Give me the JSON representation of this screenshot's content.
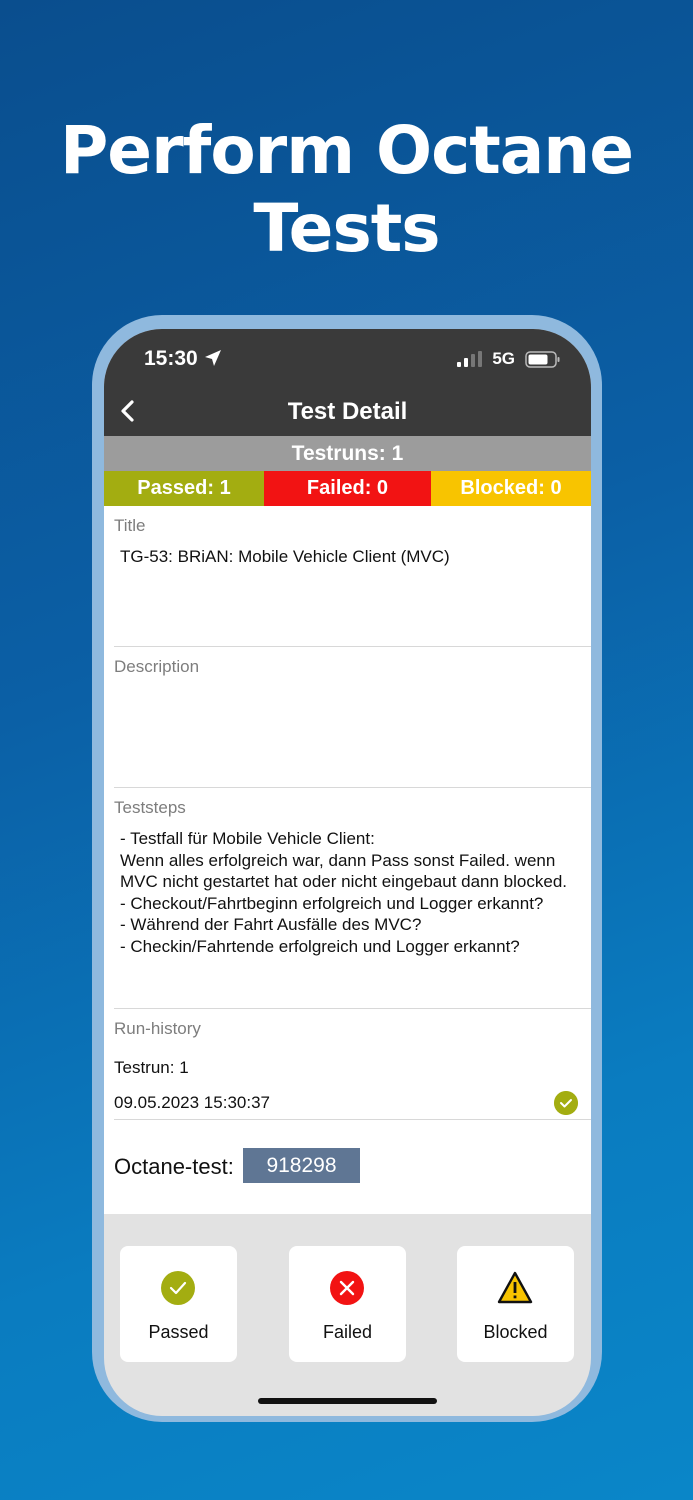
{
  "headline": {
    "line1": "Perform Octane",
    "line2": "Tests"
  },
  "status_bar": {
    "time": "15:30",
    "network": "5G"
  },
  "nav": {
    "title": "Test Detail"
  },
  "summary": {
    "testruns": "Testruns: 1",
    "passed": "Passed: 1",
    "failed": "Failed: 0",
    "blocked": "Blocked: 0"
  },
  "fields": {
    "title_label": "Title",
    "title_value": "TG-53: BRiAN: Mobile Vehicle Client (MVC)",
    "description_label": "Description",
    "description_value": "",
    "teststeps_label": "Teststeps",
    "teststeps_value": "- Testfall für Mobile Vehicle Client:\nWenn alles erfolgreich war, dann Pass sonst Failed. wenn MVC nicht gestartet hat oder nicht eingebaut dann blocked.\n- Checkout/Fahrtbeginn erfolgreich und Logger erkannt?\n- Während der Fahrt Ausfälle des MVC?\n- Checkin/Fahrtende erfolgreich und Logger erkannt?"
  },
  "run_history": {
    "label": "Run-history",
    "run_name": "Testrun: 1",
    "run_time": "09.05.2023 15:30:37"
  },
  "octane": {
    "label": "Octane-test:",
    "value": "918298"
  },
  "actions": {
    "passed": "Passed",
    "failed": "Failed",
    "blocked": "Blocked"
  },
  "colors": {
    "passed": "#a3ad11",
    "failed": "#f21313",
    "blocked": "#f8c400",
    "header": "#3a3a3a",
    "octane_box": "#5f7694"
  },
  "icons": [
    "location-arrow-icon",
    "signal-icon",
    "battery-icon",
    "back-chevron-icon",
    "check-circle-icon",
    "x-circle-icon",
    "warning-triangle-icon"
  ]
}
